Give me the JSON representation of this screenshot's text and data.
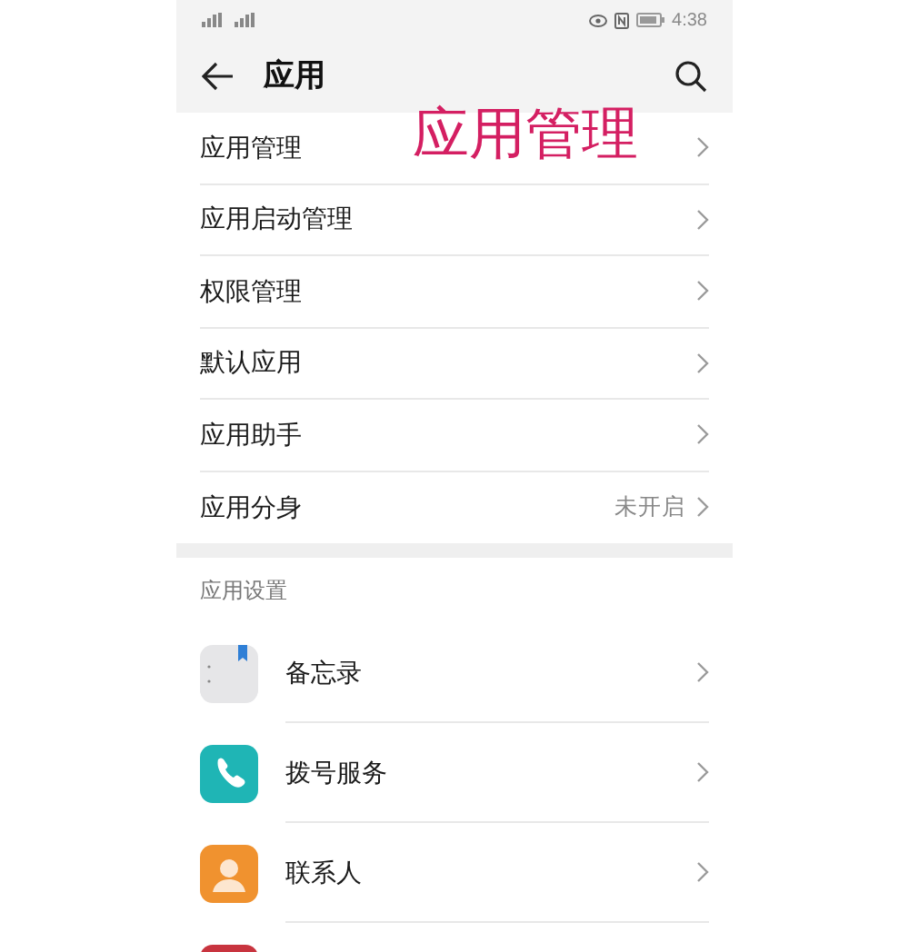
{
  "status_bar": {
    "time": "4:38"
  },
  "header": {
    "title": "应用"
  },
  "annotation": "应用管理",
  "menu_items": [
    {
      "label": "应用管理"
    },
    {
      "label": "应用启动管理"
    },
    {
      "label": "权限管理"
    },
    {
      "label": "默认应用"
    },
    {
      "label": "应用助手"
    },
    {
      "label": "应用分身",
      "value": "未开启"
    }
  ],
  "section": {
    "title": "应用设置"
  },
  "apps": [
    {
      "kind": "notes",
      "label": "备忘录"
    },
    {
      "kind": "phone",
      "label": "拨号服务"
    },
    {
      "kind": "contacts",
      "label": "联系人"
    },
    {
      "kind": "red"
    }
  ]
}
